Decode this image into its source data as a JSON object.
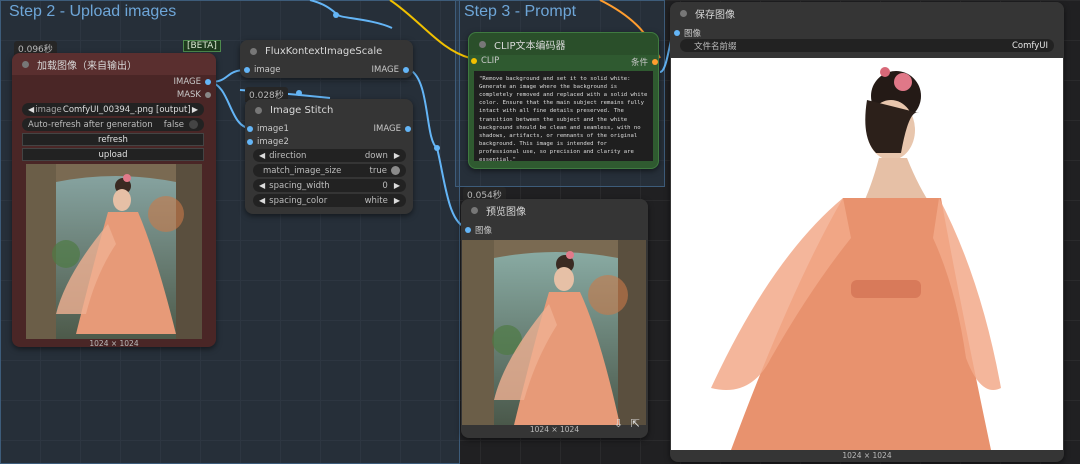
{
  "groups": {
    "step2_title": "Step 2 - Upload images",
    "step3_title": "Step 3 - Prompt"
  },
  "load_image": {
    "timing": "0.096秒",
    "badge": "[BETA]",
    "title": "加载图像（来自输出）",
    "out_image": "IMAGE",
    "out_mask": "MASK",
    "image_label": "image",
    "image_value": "ComfyUI_00394_.png [output]",
    "auto_refresh_label": "Auto-refresh after generation",
    "auto_refresh_value": "false",
    "refresh_button": "refresh",
    "upload_button": "upload",
    "resolution": "1024 × 1024"
  },
  "flux_scale": {
    "title": "FluxKontextImageScale",
    "in_image": "image",
    "out_image": "IMAGE"
  },
  "image_stitch": {
    "timing": "0.028秒",
    "title": "Image Stitch",
    "in_image1": "image1",
    "in_image2": "image2",
    "out_image": "IMAGE",
    "widgets": [
      {
        "label": "direction",
        "value": "down"
      },
      {
        "label": "match_image_size",
        "value": "true"
      },
      {
        "label": "spacing_width",
        "value": "0"
      },
      {
        "label": "spacing_color",
        "value": "white"
      }
    ]
  },
  "clip_encode": {
    "title": "CLIP文本编码器",
    "in_clip": "CLIP",
    "out_cond": "条件",
    "text": "\"Remove background and set it to solid white: Generate an image where the background is completely removed and replaced with a solid white color. Ensure that the main subject remains fully intact with all fine details preserved. The transition between the subject and the white background should be clean and seamless, with no shadows, artifacts, or remnants of the original background. This image is intended for professional use, so precision and clarity are essential.\""
  },
  "preview": {
    "timing": "0.054秒",
    "title": "预览图像",
    "in_image": "图像",
    "resolution": "1024 × 1024"
  },
  "save": {
    "title": "保存图像",
    "in_image": "图像",
    "prefix_label": "文件名前缀",
    "prefix_value": "ComfyUI",
    "resolution": "1024 × 1024"
  },
  "colors": {
    "image_wire": "#64b5f6",
    "clip_wire": "#f0c000",
    "cond_wire": "#ff9d2f",
    "load_node": "#5a2f2f",
    "clip_node": "#2f5a30"
  }
}
